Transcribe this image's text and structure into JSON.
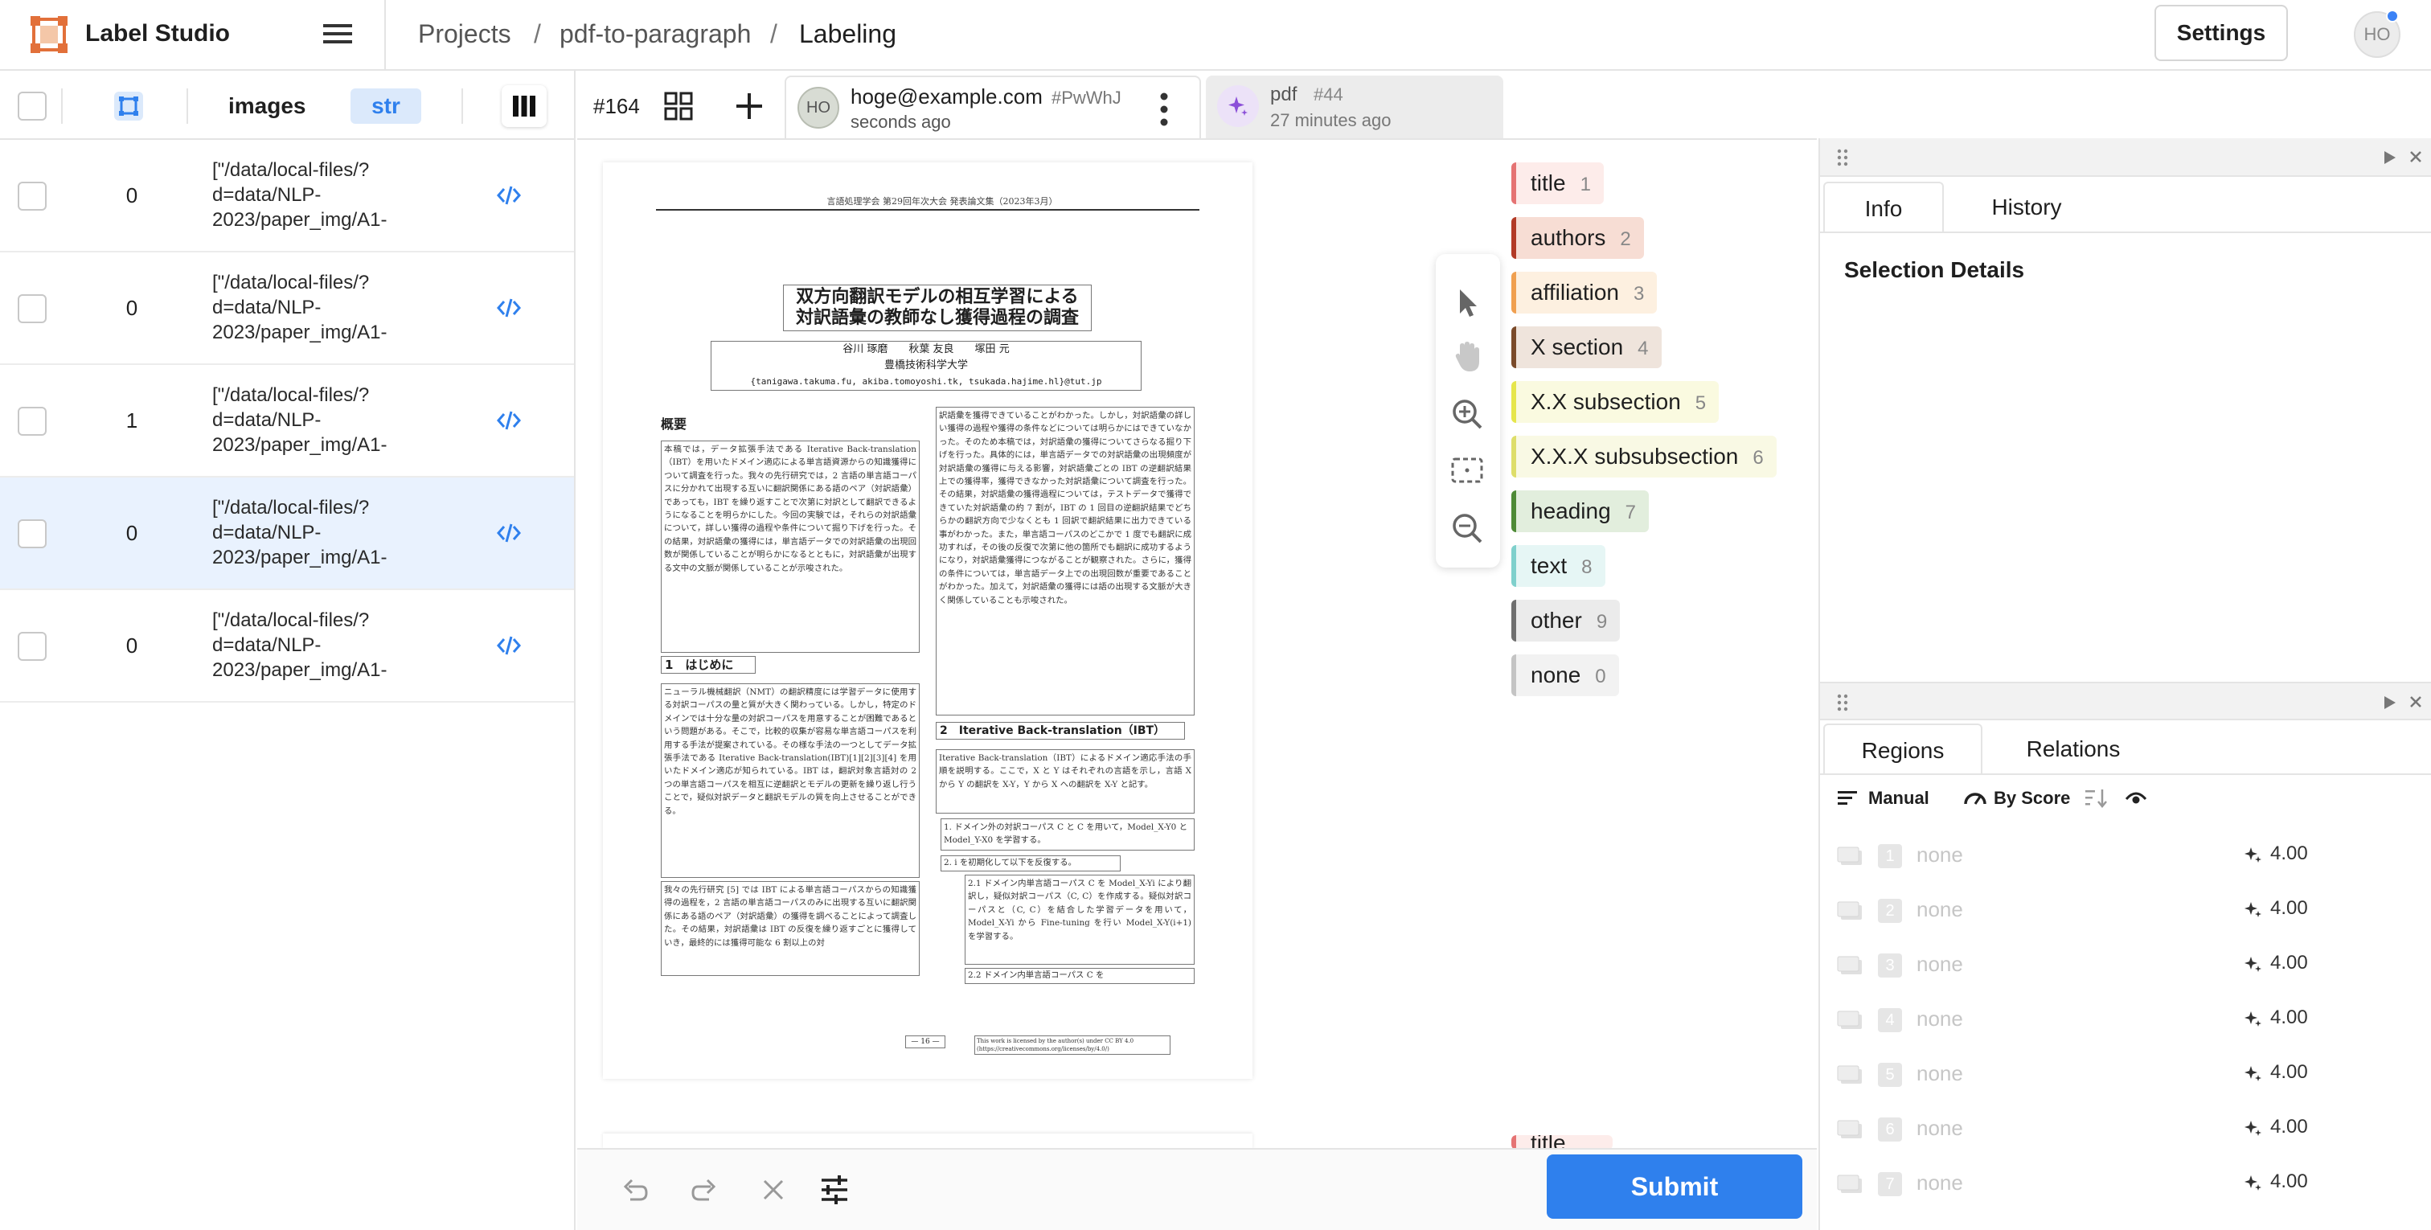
{
  "app": {
    "title": "Label Studio"
  },
  "breadcrumb": {
    "projects": "Projects",
    "sep": "/",
    "project": "pdf-to-paragraph",
    "current": "Labeling"
  },
  "header": {
    "settings": "Settings",
    "user_initials": "HO"
  },
  "tasklist": {
    "columns": {
      "images": "images",
      "type_badge": "str"
    },
    "rows": [
      {
        "count": "0",
        "path": "[\"/data/local-files/?d=data/NLP-2023/paper_img/A1-",
        "selected": false
      },
      {
        "count": "0",
        "path": "[\"/data/local-files/?d=data/NLP-2023/paper_img/A1-",
        "selected": false
      },
      {
        "count": "1",
        "path": "[\"/data/local-files/?d=data/NLP-2023/paper_img/A1-",
        "selected": false
      },
      {
        "count": "0",
        "path": "[\"/data/local-files/?d=data/NLP-2023/paper_img/A1-",
        "selected": true
      },
      {
        "count": "0",
        "path": "[\"/data/local-files/?d=data/NLP-2023/paper_img/A1-",
        "selected": false
      }
    ]
  },
  "task": {
    "id": "#164",
    "annotation": {
      "user": "hoge@example.com",
      "hash": "#PwWhJ",
      "time": "seconds ago",
      "initials": "HO"
    },
    "prediction": {
      "model": "pdf",
      "hash": "#44",
      "time": "27 minutes ago"
    }
  },
  "document": {
    "header_line": "言語処理学会 第29回年次大会 発表論文集（2023年3月）",
    "title_line1": "双方向翻訳モデルの相互学習による",
    "title_line2": "対訳語彙の教師なし獲得過程の調査",
    "authors": "谷川 琢磨　　秋葉 友良　　塚田 元",
    "affiliation": "豊橋技術科学大学",
    "emails": "{tanigawa.takuma.fu, akiba.tomoyoshi.tk, tsukada.hajime.hl}@tut.jp",
    "abstract_heading": "概要",
    "abstract_text": "本稿では，データ拡張手法である Iterative Back-translation（IBT）を用いたドメイン適応による単言語資源からの知識獲得について調査を行った。我々の先行研究では，2 言語の単言語コーパスに分かれて出現する互いに翻訳関係にある語のペア（対訳語彙）であっても，IBT を繰り返すことで次第に対訳として翻訳できるようになることを明らかにした。今回の実験では，それらの対訳語彙について，詳しい獲得の過程や条件について掘り下げを行った。その結果，対訳語彙の獲得には，単言語データでの対訳語彙の出現回数が関係していることが明らかになるとともに，対訳語彙が出現する文中の文脈が関係していることが示唆された。",
    "sec1_heading": "1　はじめに",
    "sec1_text": "ニューラル機械翻訳（NMT）の翻訳精度には学習データに使用する対訳コーパスの量と質が大きく関わっている。しかし，特定のドメインでは十分な量の対訳コーパスを用意することが困難であるという問題がある。そこで，比較的収集が容易な単言語コーパスを利用する手法が提案されている。その様な手法の一つとしてデータ拡張手法である Iterative Back-translation(IBT)[1][2][3][4] を用いたドメイン適応が知られている。IBT は，翻訳対象言語対の 2 つの単言語コーパスを相互に逆翻訳とモデルの更新を繰り返し行うことで，疑似対訳データと翻訳モデルの質を向上させることができる。",
    "sec1_text2": "我々の先行研究 [5] では IBT による単言語コーパスからの知識獲得の過程を，2 言語の単言語コーパスのみに出現する互いに翻訳関係にある語のペア（対訳語彙）の獲得を調べることによって調査した。その結果，対訳語彙は IBT の反復を繰り返すごとに獲得していき，最終的には獲得可能な 6 割以上の対",
    "right_col_text": "訳語彙を獲得できていることがわかった。しかし，対訳語彙の詳しい獲得の過程や獲得の条件などについては明らかにはできていなかった。そのため本稿では，対訳語彙の獲得についてさらなる掘り下げを行った。具体的には，単言語データでの対訳語彙の出現頻度が対訳語彙の獲得に与える影響，対訳語彙ごとの IBT の逆翻訳結果上での獲得率，獲得できなかった対訳語彙について調査を行った。その結果，対訳語彙の獲得過程については，テストデータで獲得できていた対訳語彙の約 7 割が，IBT の 1 回目の逆翻訳結果でどちらかの翻訳方向で少なくとも 1 回訳で翻訳結果に出力できている事がわかった。また，単言語コーパスのどこかで 1 度でも翻訳に成功すれば，その後の反復で次第に他の箇所でも翻訳に成功するようになり，対訳語彙獲得につながることが観察された。さらに，獲得の条件については，単言語データ上での出現回数が重要であることがわかった。加えて，対訳語彙の獲得には語の出現する文脈が大きく関係していることも示唆された。",
    "sec2_heading": "2　Iterative Back-translation（IBT）",
    "sec2_text": "Iterative Back-translation（IBT）によるドメイン適応手法の手順を説明する。ここで，X と Y はそれぞれの言語を示し，言語 X から Y の翻訳を X-Y，Y から X への翻訳を X-Y と記す。",
    "step1": "1. ドメイン外の対訳コーパス C と C を用いて，Model_X-Y0 と Model_Y-X0 を学習する。",
    "step2": "2. i を初期化して以下を反復する。",
    "step21": "2.1 ドメイン内単言語コーパス C を Model_X-Yi により翻訳し，疑似対訳コーパス（C, C）を作成する。疑似対訳コーパスと（C, C）を結合した学習データを用いて，Model_X-Yi から Fine-tuning を行い Model_X-Y(i+1) を学習する。",
    "step22": "2.2 ドメイン内単言語コーパス C を",
    "page_no": "— 16 —",
    "license": "This work is licensed by the author(s) under CC BY 4.0 (https://creativecommons.org/licenses/by/4.0/)"
  },
  "labels": [
    {
      "name": "title",
      "hotkey": "1",
      "color": "#e57373",
      "bg": "#fdecea"
    },
    {
      "name": "authors",
      "hotkey": "2",
      "color": "#b23a26",
      "bg": "#f7ddd4"
    },
    {
      "name": "affiliation",
      "hotkey": "3",
      "color": "#f0a050",
      "bg": "#fdf0e0"
    },
    {
      "name": "X section",
      "hotkey": "4",
      "color": "#7a4a2a",
      "bg": "#efe4dc"
    },
    {
      "name": "X.X subsection",
      "hotkey": "5",
      "color": "#e6e64c",
      "bg": "#fafae0"
    },
    {
      "name": "X.X.X subsubsection",
      "hotkey": "6",
      "color": "#dede6a",
      "bg": "#f9f9e4"
    },
    {
      "name": "heading",
      "hotkey": "7",
      "color": "#4e8a36",
      "bg": "#e2eedd"
    },
    {
      "name": "text",
      "hotkey": "8",
      "color": "#7fd0cc",
      "bg": "#e6f6f5"
    },
    {
      "name": "other",
      "hotkey": "9",
      "color": "#6f6f6f",
      "bg": "#ebebeb"
    },
    {
      "name": "none",
      "hotkey": "0",
      "color": "#c4c4c4",
      "bg": "#f2f2f2"
    }
  ],
  "second_page_label": "title",
  "info_panel": {
    "tabs": [
      "Info",
      "History"
    ],
    "active": "Info",
    "title": "Selection Details"
  },
  "regions_panel": {
    "tabs": [
      "Regions",
      "Relations"
    ],
    "active": "Regions",
    "order": "Manual",
    "sort": "By Score",
    "rows": [
      {
        "index": "1",
        "label": "none",
        "score": "4.00"
      },
      {
        "index": "2",
        "label": "none",
        "score": "4.00"
      },
      {
        "index": "3",
        "label": "none",
        "score": "4.00"
      },
      {
        "index": "4",
        "label": "none",
        "score": "4.00"
      },
      {
        "index": "5",
        "label": "none",
        "score": "4.00"
      },
      {
        "index": "6",
        "label": "none",
        "score": "4.00"
      },
      {
        "index": "7",
        "label": "none",
        "score": "4.00"
      }
    ]
  },
  "actions": {
    "submit": "Submit"
  },
  "colors": {
    "accent": "#2f80ed",
    "selected_row": "#e9f2fe",
    "logo": "#e2703a"
  }
}
